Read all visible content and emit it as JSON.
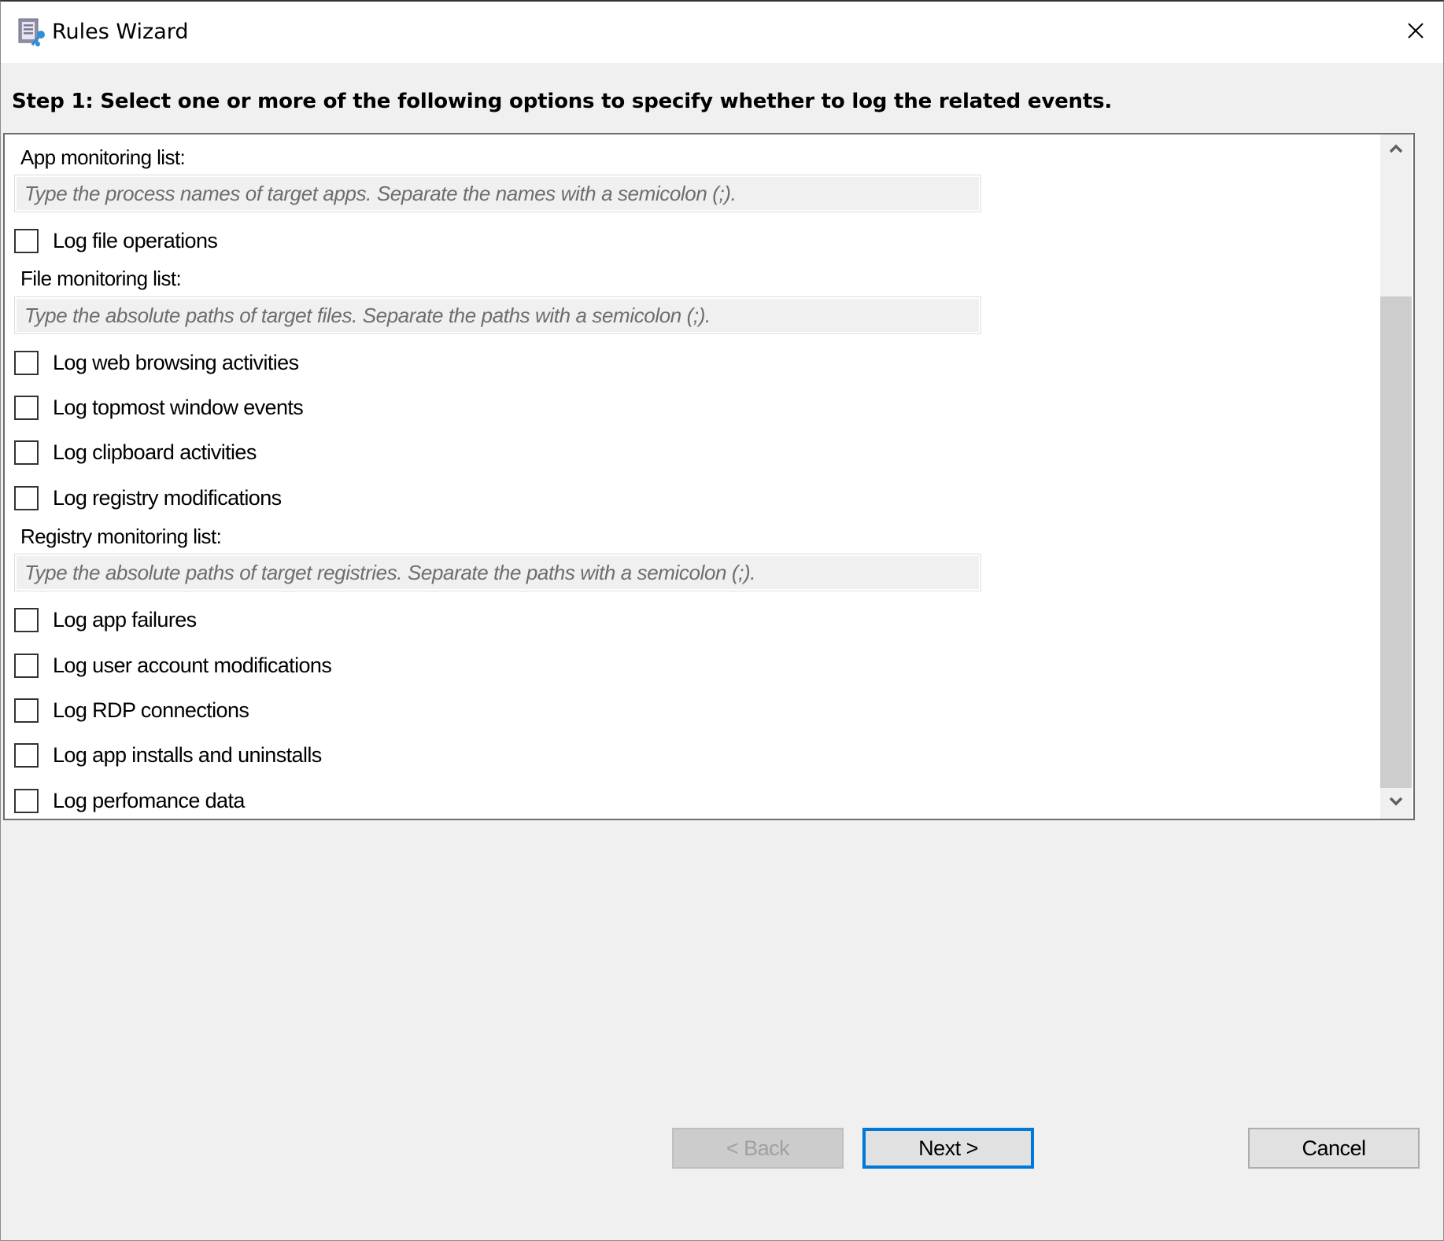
{
  "window": {
    "title": "Rules Wizard",
    "icon": "rules-wizard-icon",
    "close_icon": "close-icon"
  },
  "step_heading": "Step 1: Select one or more of the following options to specify whether to log the related events.",
  "panel": {
    "app_monitoring": {
      "label": "App monitoring list:",
      "value": "",
      "placeholder": "Type the process names of target apps. Separate the names with a semicolon (;)."
    },
    "log_file_operations": {
      "label": "Log file operations",
      "checked": false
    },
    "file_monitoring": {
      "label": "File monitoring list:",
      "value": "",
      "placeholder": "Type the absolute paths of target files. Separate the paths with a semicolon (;)."
    },
    "log_web_browsing": {
      "label": "Log web browsing activities",
      "checked": false
    },
    "log_topmost_window": {
      "label": "Log topmost window events",
      "checked": false
    },
    "log_clipboard": {
      "label": "Log clipboard activities",
      "checked": false
    },
    "log_registry": {
      "label": "Log registry modifications",
      "checked": false
    },
    "registry_monitoring": {
      "label": "Registry monitoring list:",
      "value": "",
      "placeholder": "Type the absolute paths of target registries. Separate the paths with a semicolon (;)."
    },
    "log_app_failures": {
      "label": "Log app failures",
      "checked": false
    },
    "log_user_account": {
      "label": "Log user account modifications",
      "checked": false
    },
    "log_rdp": {
      "label": "Log RDP connections",
      "checked": false
    },
    "log_app_installs": {
      "label": "Log app installs and uninstalls",
      "checked": false
    },
    "log_performance": {
      "label": "Log perfomance data",
      "checked": false
    },
    "scrollbar": {
      "up_icon": "chevron-up-icon",
      "down_icon": "chevron-down-icon"
    }
  },
  "buttons": {
    "back": {
      "label": "< Back",
      "enabled": false
    },
    "next": {
      "label": "Next >",
      "enabled": true,
      "focused": true
    },
    "cancel": {
      "label": "Cancel",
      "enabled": true
    }
  },
  "colors": {
    "focus_accent": "#0078d7",
    "dialog_bg": "#f0f0f0",
    "scroll_thumb": "#cdcdcd"
  }
}
